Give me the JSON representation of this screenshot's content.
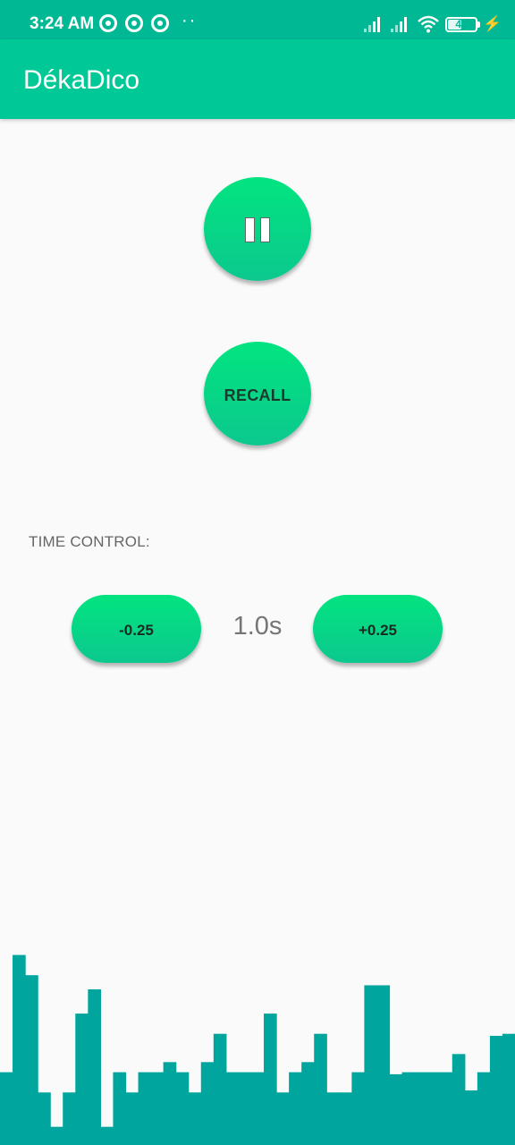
{
  "status_bar": {
    "time": "3:24 AM",
    "notification_icons": [
      "notification-icon",
      "notification-icon",
      "notification-icon"
    ],
    "dots": "··",
    "battery_level": "49",
    "battery_fraction": 0.49
  },
  "app_bar": {
    "title": "DékaDico"
  },
  "controls": {
    "pause_icon": "pause-icon",
    "recall_label": "RECALL",
    "time_control_label": "TIME CONTROL:",
    "decrease_label": "-0.25",
    "increase_label": "+0.25",
    "time_value": "1.0s"
  },
  "colors": {
    "status_bar": "#00b894",
    "app_bar": "#00c896",
    "button_top": "#02e47f",
    "button_bottom": "#0cc88f",
    "visualizer": "#00a69e"
  },
  "visualizer_levels": [
    0.36,
    0.94,
    0.84,
    0.26,
    0.09,
    0.26,
    0.65,
    0.77,
    0.09,
    0.36,
    0.26,
    0.36,
    0.36,
    0.41,
    0.36,
    0.26,
    0.41,
    0.55,
    0.36,
    0.36,
    0.36,
    0.65,
    0.26,
    0.36,
    0.41,
    0.55,
    0.26,
    0.26,
    0.36,
    0.79,
    0.79,
    0.35,
    0.36,
    0.36,
    0.36,
    0.36,
    0.45,
    0.27,
    0.36,
    0.54,
    0.55
  ]
}
